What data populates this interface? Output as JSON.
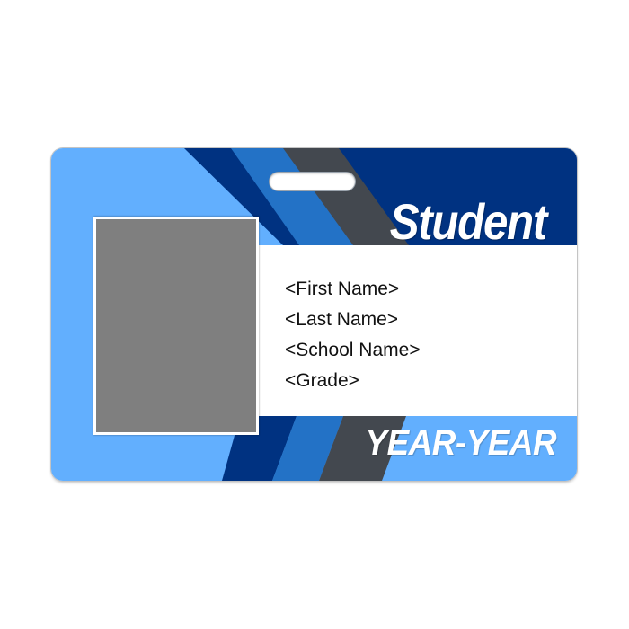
{
  "card": {
    "title": "Student",
    "fields": [
      {
        "id": "first-name",
        "text": "<First Name>"
      },
      {
        "id": "last-name",
        "text": "<Last Name>"
      },
      {
        "id": "school-name",
        "text": "<School Name>"
      },
      {
        "id": "grade",
        "text": "<Grade>"
      }
    ],
    "year": "YEAR-YEAR",
    "photo_placeholder_color": "#7f7f7f"
  },
  "colors": {
    "light_blue": "#62affe",
    "navy": "#003281",
    "mid_blue": "#2372c6",
    "dark_gray": "#43484f",
    "white": "#ffffff"
  }
}
